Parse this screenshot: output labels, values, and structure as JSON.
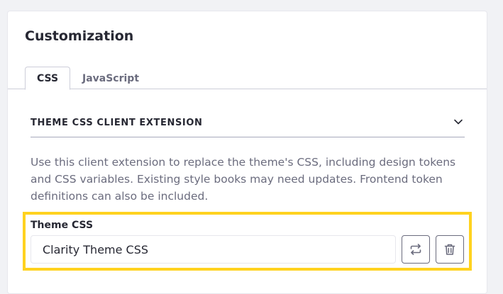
{
  "panel": {
    "title": "Customization"
  },
  "tabs": [
    {
      "label": "CSS",
      "active": true
    },
    {
      "label": "JavaScript",
      "active": false
    }
  ],
  "section": {
    "title": "THEME CSS CLIENT EXTENSION",
    "expanded": true,
    "description": "Use this client extension to replace the theme's CSS, including design tokens and CSS variables. Existing style books may need updates. Frontend token definitions can also be included."
  },
  "field": {
    "label": "Theme CSS",
    "value": "Clarity Theme CSS",
    "replace_icon": "replace-icon",
    "delete_icon": "trash-icon"
  },
  "colors": {
    "highlight": "#ffd21f",
    "text": "#272833",
    "secondary_text": "#6b6c7e",
    "border": "#e7e7ed"
  }
}
